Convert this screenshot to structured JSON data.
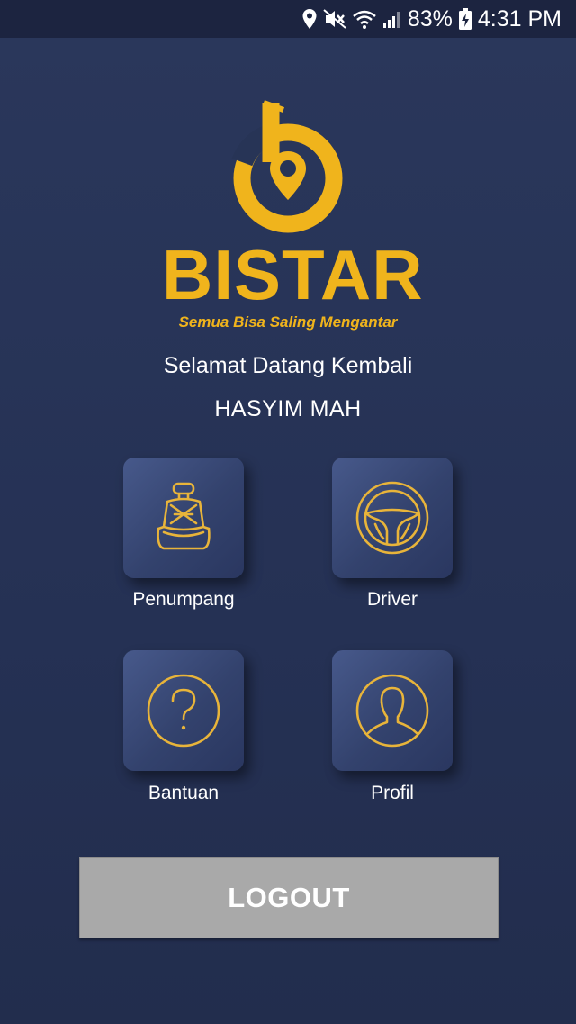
{
  "status_bar": {
    "battery_percent": "83%",
    "time": "4:31 PM",
    "icons": [
      "location-icon",
      "mute-icon",
      "wifi-icon",
      "signal-icon",
      "battery-charging-icon"
    ]
  },
  "brand": {
    "name": "BISTAR",
    "tagline": "Semua Bisa Saling Mengantar",
    "color": "#f0b41c"
  },
  "greeting": {
    "welcome": "Selamat Datang Kembali",
    "user_name": "HASYIM MAH"
  },
  "menu": [
    {
      "label": "Penumpang",
      "icon": "car-seat-icon"
    },
    {
      "label": "Driver",
      "icon": "steering-wheel-icon"
    },
    {
      "label": "Bantuan",
      "icon": "help-question-icon"
    },
    {
      "label": "Profil",
      "icon": "profile-user-icon"
    }
  ],
  "logout": {
    "label": "LOGOUT"
  },
  "colors": {
    "background": "#273456",
    "status_bar": "#1c2440",
    "accent": "#f0b41c",
    "tile": "#3a4a78",
    "logout_button": "#a9a9a9"
  }
}
